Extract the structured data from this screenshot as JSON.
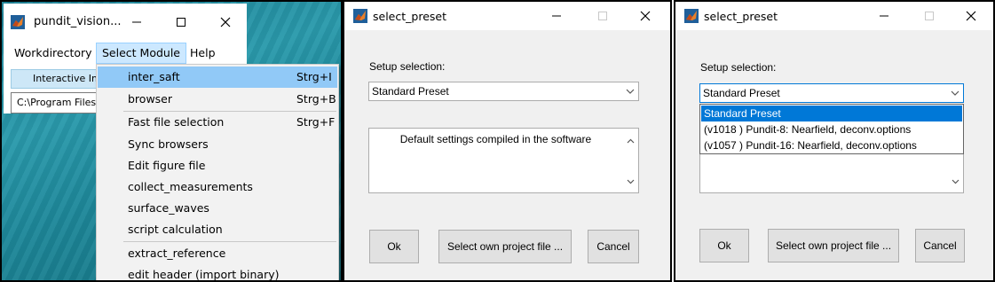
{
  "panel1": {
    "window_title": "pundit_vision...",
    "menus": [
      "Workdirectory",
      "Select Module",
      "Help"
    ],
    "active_menu": "Select Module",
    "partial_button": "Interactive Im",
    "partial_field": "C:\\Program Files\\",
    "dropdown_items": [
      {
        "label": "inter_saft",
        "shortcut": "Strg+I"
      },
      {
        "label": "browser",
        "shortcut": "Strg+B"
      },
      {
        "label": "Fast file selection",
        "shortcut": "Strg+F"
      },
      {
        "label": "Sync browsers",
        "shortcut": ""
      },
      {
        "label": "Edit figure file",
        "shortcut": ""
      },
      {
        "label": "collect_measurements",
        "shortcut": ""
      },
      {
        "label": "surface_waves",
        "shortcut": ""
      },
      {
        "label": "script calculation",
        "shortcut": ""
      },
      {
        "label": "extract_reference",
        "shortcut": ""
      },
      {
        "label": "edit header (import binary)",
        "shortcut": ""
      }
    ],
    "highlighted_item": "inter_saft"
  },
  "panel2": {
    "window_title": "select_preset",
    "setup_label": "Setup selection:",
    "selected_preset": "Standard Preset",
    "description": "Default settings compiled in the software",
    "buttons": {
      "ok": "Ok",
      "own_file": "Select own project file ...",
      "cancel": "Cancel"
    }
  },
  "panel3": {
    "window_title": "select_preset",
    "setup_label": "Setup selection:",
    "selected_preset": "Standard Preset",
    "options": [
      "Standard Preset",
      "(v1018 ) Pundit-8: Nearfield, deconv.options",
      "(v1057 ) Pundit-16: Nearfield, deconv.options"
    ],
    "buttons": {
      "ok": "Ok",
      "own_file": "Select own project file ...",
      "cancel": "Cancel"
    }
  },
  "colors": {
    "teal_background": "#1b8799",
    "menu_active": "#cce8ff",
    "item_highlight": "#91c9f7",
    "list_selection": "#0078d7",
    "dialog_background": "#f0f0f0",
    "button_face": "#e1e1e1"
  }
}
